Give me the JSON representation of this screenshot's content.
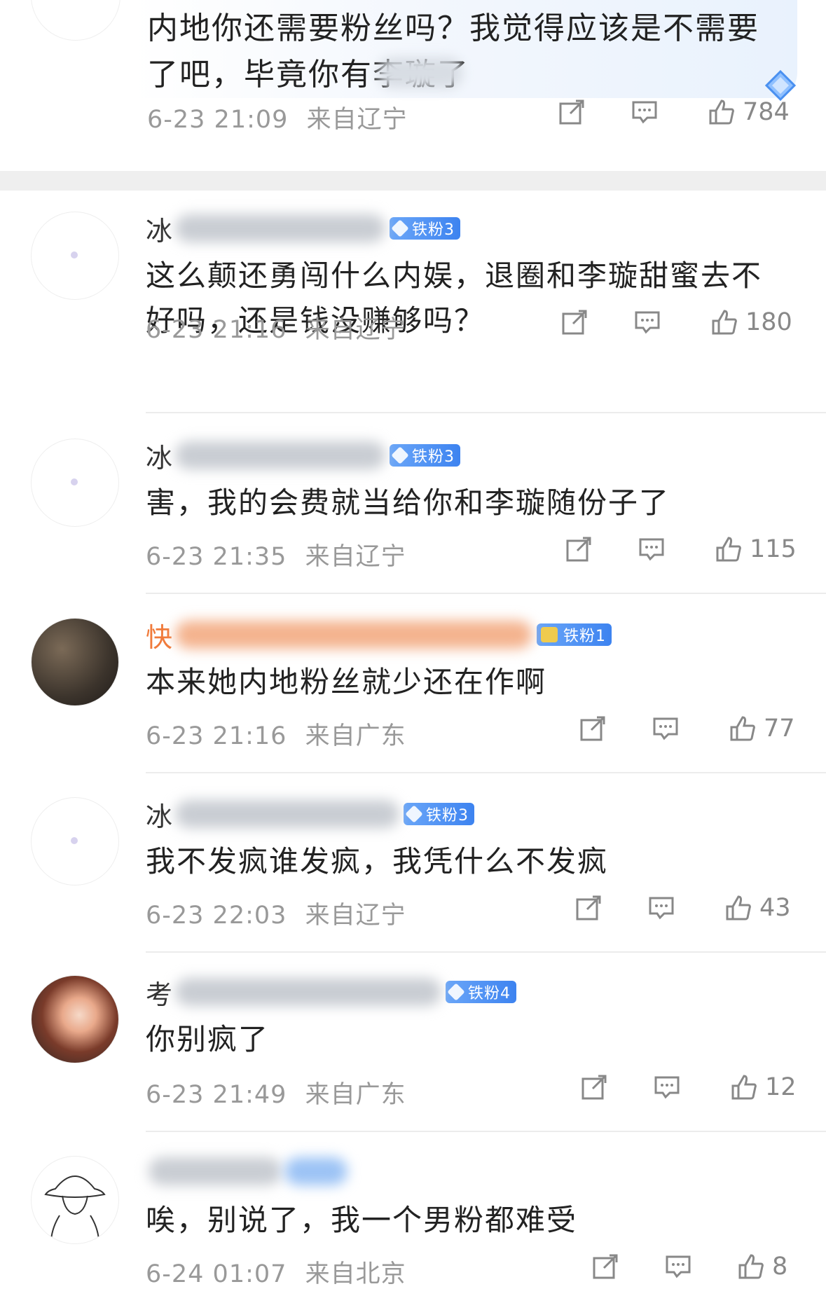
{
  "top_comment": {
    "text_line1": "内地你还需要粉丝吗？我觉得应该是不需要",
    "text_line2": "了吧，毕竟你有李璇了",
    "time": "6-23 21:09",
    "location": "来自辽宁",
    "likes": "784"
  },
  "comments": [
    {
      "name_lead": "冰",
      "badge": "铁粉3",
      "text": "这么颠还勇闯什么内娱，退圈和李璇甜蜜去不好吗，还是钱没赚够吗？",
      "time": "6-23 21:16",
      "location": "来自辽宁",
      "likes": "180"
    },
    {
      "name_lead": "冰",
      "badge": "铁粉3",
      "text": "害，我的会费就当给你和李璇随份子了",
      "time": "6-23 21:35",
      "location": "来自辽宁",
      "likes": "115"
    },
    {
      "name_lead": "快",
      "badge": "铁粉1",
      "text": "本来她内地粉丝就少还在作啊",
      "time": "6-23 21:16",
      "location": "来自广东",
      "likes": "77"
    },
    {
      "name_lead": "冰",
      "badge": "铁粉3",
      "text": "我不发疯谁发疯，我凭什么不发疯",
      "time": "6-23 22:03",
      "location": "来自辽宁",
      "likes": "43"
    },
    {
      "name_lead": "考",
      "badge": "铁粉4",
      "text": "你别疯了",
      "time": "6-23 21:49",
      "location": "来自广东",
      "likes": "12"
    },
    {
      "name_lead": "",
      "badge": "",
      "text": "唉，别说了，我一个男粉都难受",
      "time": "6-24 01:07",
      "location": "来自北京",
      "likes": "8"
    }
  ],
  "icons": {
    "share": "share-icon",
    "comment": "comment-icon",
    "like": "thumbs-up-icon"
  },
  "colors": {
    "badge_blue": "#3d83f0",
    "meta_gray": "#999999",
    "name_orange": "#f07a3a"
  }
}
